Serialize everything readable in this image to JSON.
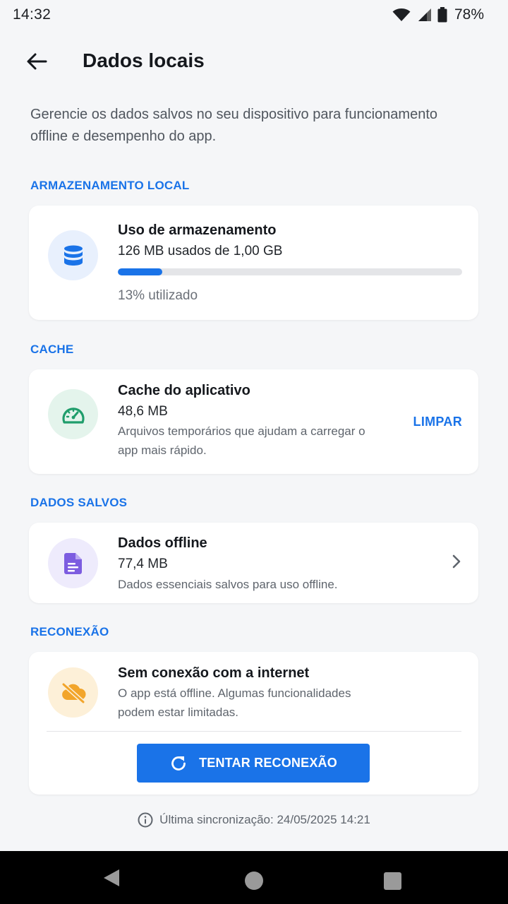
{
  "status_bar": {
    "time": "14:32",
    "battery": "78%"
  },
  "header": {
    "title": "Dados locais"
  },
  "description": "Gerencie os dados salvos no seu dispositivo para funcionamento offline e desempenho do app.",
  "sections": {
    "storage": {
      "label": "ARMAZENAMENTO LOCAL",
      "title": "Uso de armazenamento",
      "value": "126 MB usados de 1,00 GB",
      "progress_fraction": 0.13,
      "usage_text": "13% utilizado"
    },
    "cache": {
      "label": "CACHE",
      "title": "Cache do aplicativo",
      "value": "48,6 MB",
      "description": "Arquivos temporários que ajudam a carregar o app mais rápido.",
      "action_label": "LIMPAR"
    },
    "saved": {
      "label": "DADOS SALVOS",
      "title": "Dados offline",
      "value": "77,4 MB",
      "description": "Dados essenciais salvos para uso offline."
    },
    "reconnect": {
      "label": "RECONEXÃO",
      "title": "Sem conexão com a internet",
      "description": "O app está offline. Algumas funcionalidades podem estar limitadas.",
      "button_label": "TENTAR RECONEXÃO"
    }
  },
  "footer": {
    "last_sync": "Última sincronização: 24/05/2025 14:21"
  },
  "colors": {
    "accent": "#1a73e8",
    "background": "#f5f6f8",
    "storage_icon_bg": "#e8f0fd",
    "cache_icon_bg": "#e4f4ec",
    "cache_icon": "#1f9d6b",
    "saved_icon_bg": "#eeebfc",
    "saved_icon": "#7c5ce0",
    "offline_icon_bg": "#fdf0d8",
    "offline_icon": "#f2a52b"
  },
  "icons": {
    "storage": "database-icon",
    "cache": "speedometer-icon",
    "saved": "document-icon",
    "offline": "cloud-off-icon",
    "retry": "refresh-icon",
    "info": "info-icon"
  }
}
